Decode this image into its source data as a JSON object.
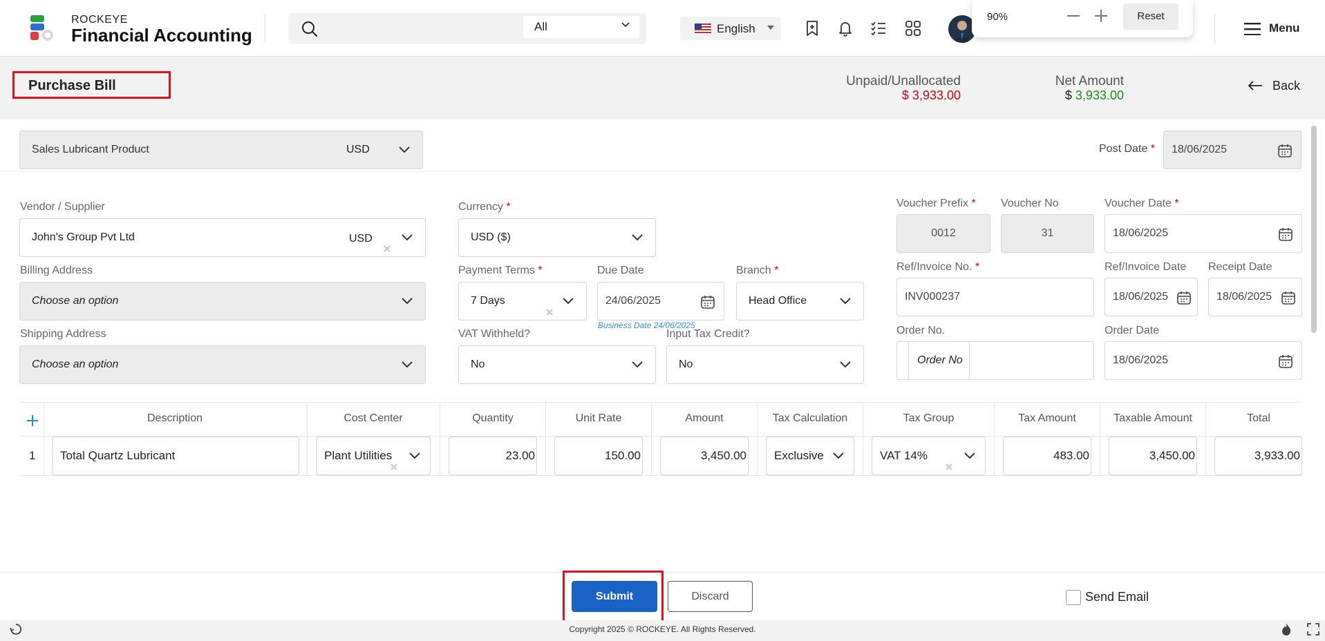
{
  "header": {
    "brand_small": "ROCKEYE",
    "brand_big": "Financial Accounting",
    "search_placeholder": "",
    "search_scope": "All",
    "language": "English",
    "zoom_level": "90%",
    "zoom_reset": "Reset",
    "menu_label": "Menu"
  },
  "titlebar": {
    "title": "Purchase Bill",
    "unpaid_label": "Unpaid/Unallocated",
    "unpaid_value": "$ 3,933.00",
    "net_label": "Net Amount",
    "net_currency": "$",
    "net_value": "3,933.00",
    "back_label": "Back"
  },
  "top_row": {
    "product": "Sales Lubricant Product",
    "product_currency": "USD",
    "post_date_label": "Post Date",
    "post_date": "18/06/2025"
  },
  "form": {
    "vendor_label": "Vendor / Supplier",
    "vendor_value": "John's Group Pvt Ltd",
    "vendor_currency": "USD",
    "billing_label": "Billing Address",
    "billing_value": "Choose an option",
    "shipping_label": "Shipping Address",
    "shipping_value": "Choose an option",
    "currency_label": "Currency",
    "currency_value": "USD ($)",
    "payment_terms_label": "Payment Terms",
    "payment_terms_value": "7 Days",
    "due_date_label": "Due Date",
    "due_date_value": "24/06/2025",
    "business_date_hint": "Business Date 24/06/2025",
    "branch_label": "Branch",
    "branch_value": "Head Office",
    "vat_withheld_label": "VAT Withheld?",
    "vat_withheld_value": "No",
    "input_tax_label": "Input Tax Credit?",
    "input_tax_value": "No",
    "voucher_prefix_label": "Voucher Prefix",
    "voucher_prefix_value": "0012",
    "voucher_no_label": "Voucher No",
    "voucher_no_value": "31",
    "voucher_date_label": "Voucher Date",
    "voucher_date_value": "18/06/2025",
    "ref_invoice_label": "Ref/Invoice No.",
    "ref_invoice_value": "INV000237",
    "ref_invoice_date_label": "Ref/Invoice Date",
    "ref_invoice_date_value": "18/06/2025",
    "receipt_date_label": "Receipt Date",
    "receipt_date_value": "18/06/2025",
    "order_no_label": "Order No.",
    "order_no_placeholder": "Order No",
    "order_date_label": "Order Date",
    "order_date_value": "18/06/2025"
  },
  "table": {
    "headers": [
      "Description",
      "Cost Center",
      "Quantity",
      "Unit Rate",
      "Amount",
      "Tax Calculation",
      "Tax Group",
      "Tax Amount",
      "Taxable Amount",
      "Total"
    ],
    "rows": [
      {
        "num": "1",
        "description": "Total Quartz Lubricant",
        "cost_center": "Plant Utilities",
        "quantity": "23.00",
        "unit_rate": "150.00",
        "amount": "3,450.00",
        "tax_calculation": "Exclusive",
        "tax_group": "VAT 14%",
        "tax_amount": "483.00",
        "taxable_amount": "3,450.00",
        "total": "3,933.00"
      }
    ]
  },
  "footer": {
    "submit_label": "Submit",
    "discard_label": "Discard",
    "send_email_label": "Send Email",
    "copyright": "Copyright 2025 © ROCKEYE. All Rights Reserved."
  },
  "colors": {
    "primary": "#1a63c6",
    "danger": "#d0021b",
    "success": "#1a8a1a",
    "highlight": "#e0101c"
  }
}
